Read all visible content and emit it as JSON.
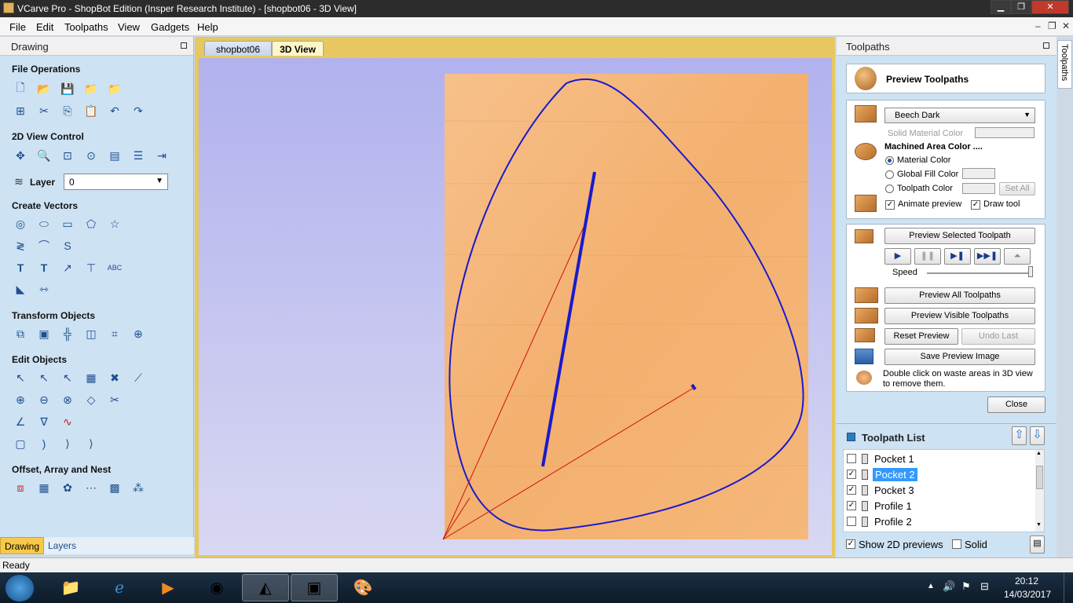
{
  "window": {
    "title": "VCarve Pro - ShopBot Edition (Insper Research Institute) - [shopbot06 - 3D View]"
  },
  "menu": [
    "File",
    "Edit",
    "Toolpaths",
    "View",
    "Gadgets",
    "Help"
  ],
  "left_panel": {
    "title": "Drawing",
    "sections": {
      "file_ops": "File Operations",
      "view_control": "2D View Control",
      "layer_label": "Layer",
      "layer_value": "0",
      "create_vectors": "Create Vectors",
      "transform": "Transform Objects",
      "edit": "Edit Objects",
      "offset": "Offset, Array and Nest"
    },
    "bottom_tabs": [
      "Drawing",
      "Layers"
    ]
  },
  "view_tabs": [
    "shopbot06",
    "3D View"
  ],
  "right_panel": {
    "title": "Toolpaths",
    "side_tab": "Toolpaths",
    "preview_title": "Preview Toolpaths",
    "material": "Beech Dark",
    "solid_material_color": "Solid Material Color",
    "machined_area_color": "Machined Area Color ....",
    "radio": [
      "Material Color",
      "Global Fill Color",
      "Toolpath Color"
    ],
    "set_all": "Set All",
    "animate_preview": "Animate preview",
    "draw_tool": "Draw tool",
    "preview_selected": "Preview Selected Toolpath",
    "speed": "Speed",
    "preview_all": "Preview All Toolpaths",
    "preview_visible": "Preview Visible Toolpaths",
    "reset_preview": "Reset Preview",
    "undo_last": "Undo Last",
    "save_preview_image": "Save Preview Image",
    "hint": "Double click on waste areas in 3D view to remove them.",
    "close": "Close",
    "toolpath_list_title": "Toolpath List",
    "toolpaths": [
      {
        "name": "Pocket 1",
        "checked": false,
        "selected": false
      },
      {
        "name": "Pocket 2",
        "checked": true,
        "selected": true
      },
      {
        "name": "Pocket 3",
        "checked": true,
        "selected": false
      },
      {
        "name": "Profile 1",
        "checked": true,
        "selected": false
      },
      {
        "name": "Profile 2",
        "checked": false,
        "selected": false
      }
    ],
    "show_2d_previews": "Show 2D previews",
    "solid": "Solid"
  },
  "status": "Ready",
  "clock": {
    "time": "20:12",
    "date": "14/03/2017"
  },
  "colors": {
    "panel_bg": "#cde2f3",
    "selection": "#3399ff",
    "toolpath": "#1a1acc",
    "wood": "#f3b06f"
  }
}
